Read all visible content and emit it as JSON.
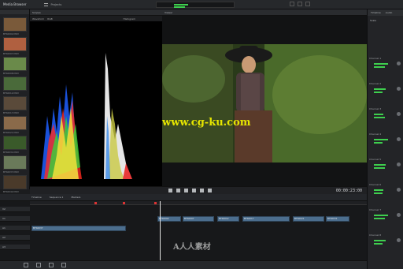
{
  "app": {
    "title": "Media Browser",
    "projects_label": "Projects"
  },
  "left": {
    "items": [
      {
        "label": "BTS0002.MOV",
        "color": "#7a5a3a"
      },
      {
        "label": "BTS0007.MOV",
        "color": "#b06040"
      },
      {
        "label": "BTS0008.MOV",
        "color": "#6a8a4a"
      },
      {
        "label": "BTS0012.MOV",
        "color": "#4a6a3a"
      },
      {
        "label": "BTS0017.MOV",
        "color": "#5a4a3a"
      },
      {
        "label": "BTS0021.MOV",
        "color": "#8a6a4a"
      },
      {
        "label": "BTS0031.MOV",
        "color": "#3a5a2a"
      },
      {
        "label": "BTS0037.MOV",
        "color": "#6a7a5a"
      },
      {
        "label": "BTS0042.MOV",
        "color": "#4a3a2a"
      }
    ]
  },
  "scopes": {
    "tab": "Scopes",
    "waveform_label": "Waveform",
    "histogram_label": "Histogram",
    "channels": [
      "RGB",
      "Y"
    ]
  },
  "video": {
    "tab": "Viewer",
    "watermark": "www.cg-ku.com"
  },
  "transport": {
    "timecode": "00:00:23:00"
  },
  "right": {
    "tab1": "Timeline",
    "tab2": "Audio",
    "scale_label": "Scale",
    "channels": [
      "Channel 1",
      "Channel 2",
      "Channel 3",
      "Channel 4",
      "Channel 5",
      "Channel 6",
      "Channel 7",
      "Channel 8"
    ]
  },
  "timeline": {
    "head": {
      "item1": "Timeline",
      "item2": "Sequence 1",
      "item3": "Markers"
    },
    "tracks": [
      {
        "label": "V2"
      },
      {
        "label": "V1"
      },
      {
        "label": "A1"
      },
      {
        "label": "A2"
      },
      {
        "label": "A3"
      }
    ],
    "clips": [
      {
        "label": "BTS0002"
      },
      {
        "label": "BTS0007"
      },
      {
        "label": "BTS0012"
      },
      {
        "label": "BTS0017"
      },
      {
        "label": "BTS0021"
      },
      {
        "label": "BTS0031"
      },
      {
        "label": "BTS0037"
      }
    ]
  },
  "bottom": {
    "watermark": "A人人素材"
  }
}
